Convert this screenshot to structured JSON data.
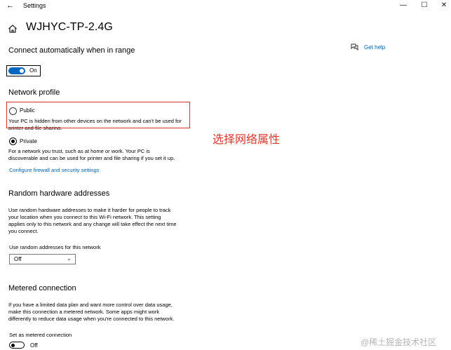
{
  "window": {
    "title": "Settings",
    "minimize_glyph": "—",
    "maximize_glyph": "☐",
    "close_glyph": "✕"
  },
  "header": {
    "title": "WJHYC-TP-2.4G"
  },
  "help": {
    "label": "Get help"
  },
  "connect_auto": {
    "heading": "Connect automatically when in range",
    "toggle_label": "On"
  },
  "network_profile": {
    "heading": "Network profile",
    "public": {
      "label": "Public",
      "description": "Your PC is hidden from other devices on the network and can't be used for printer and file sharing.",
      "selected": false
    },
    "private": {
      "label": "Private",
      "description": "For a network you trust, such as at home or work. Your PC is discoverable and can be used for printer and file sharing if you set it up.",
      "selected": true
    },
    "firewall_link": "Configure firewall and security settings"
  },
  "annotation": "选择网络属性",
  "random_hw": {
    "heading": "Random hardware addresses",
    "description": "Use random hardware addresses to make it harder for people to track your location when you connect to this Wi-Fi network. This setting applies only to this network and any change will take effect the next time you connect.",
    "dropdown_label": "Use random addresses for this network",
    "dropdown_value": "Off"
  },
  "metered": {
    "heading": "Metered connection",
    "description": "If you have a limited data plan and want more control over data usage, make this connection a metered network. Some apps might work differently to reduce data usage when you're connected to this network.",
    "toggle_caption": "Set as metered connection",
    "toggle_label": "Off"
  },
  "watermark": "@稀土掘金技术社区",
  "colors": {
    "accent": "#0067c0",
    "link": "#0063b1",
    "highlight_box": "#e0322c"
  }
}
